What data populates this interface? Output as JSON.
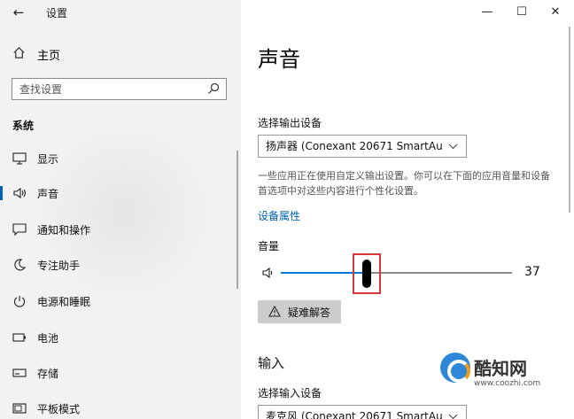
{
  "window": {
    "title": "设置",
    "back_glyph": "←",
    "minimize_glyph": "—",
    "maximize_glyph": "☐",
    "close_glyph": "✕"
  },
  "sidebar": {
    "home_label": "主页",
    "search_placeholder": "查找设置",
    "section_label": "系统",
    "items": [
      {
        "label": "显示",
        "icon": "display-icon",
        "active": false
      },
      {
        "label": "声音",
        "icon": "speaker-icon",
        "active": true
      },
      {
        "label": "通知和操作",
        "icon": "notification-icon",
        "active": false
      },
      {
        "label": "专注助手",
        "icon": "moon-icon",
        "active": false
      },
      {
        "label": "电源和睡眠",
        "icon": "power-icon",
        "active": false
      },
      {
        "label": "电池",
        "icon": "battery-icon",
        "active": false
      },
      {
        "label": "存储",
        "icon": "storage-icon",
        "active": false
      },
      {
        "label": "平板模式",
        "icon": "tablet-icon",
        "active": false
      }
    ]
  },
  "main": {
    "title": "声音",
    "output": {
      "label": "选择输出设备",
      "selected_device": "扬声器 (Conexant 20671 SmartAu",
      "description": "一些应用正在使用自定义输出设置。你可以在下面的应用音量和设备首选项中对这些内容进行个性化设置。",
      "properties_link": "设备属性",
      "volume_label": "音量",
      "volume_value": "37",
      "volume_level": 37,
      "troubleshoot_label": "疑难解答"
    },
    "input": {
      "heading": "输入",
      "label": "选择输入设备",
      "selected_device": "麦克风 (Conexant 20671 SmartAu"
    }
  },
  "watermark": {
    "name": "酷知网",
    "url": "www.coozhi.com"
  },
  "colors": {
    "accent": "#0078d7",
    "highlight": "#d9383a",
    "sidebar_bg": "#f2f2f2"
  }
}
